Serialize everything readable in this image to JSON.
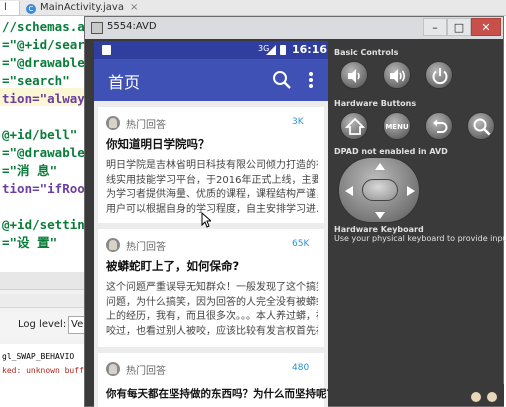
{
  "ide": {
    "tabs": [
      {
        "label": "l"
      },
      {
        "label": "MainActivity.java",
        "icon": "c-class-icon",
        "close": "×"
      }
    ],
    "code_lines": [
      [
        {
          "t": "//schemas.an",
          "c": "str"
        }
      ],
      [
        {
          "t": "=\"@+id/sear",
          "c": "str"
        }
      ],
      [
        {
          "t": "=\"@drawable",
          "c": "str"
        }
      ],
      [
        {
          "t": "=\"search\"",
          "c": "str"
        }
      ],
      [
        {
          "t": "tion=\"alway",
          "c": "attr"
        }
      ],
      [
        {
          "t": "",
          "c": "plain"
        }
      ],
      [
        {
          "t": "@+id/bell\"",
          "c": "str"
        }
      ],
      [
        {
          "t": "=\"@drawable",
          "c": "str"
        }
      ],
      [
        {
          "t": "=\"消 息\"",
          "c": "str"
        }
      ],
      [
        {
          "t": "tion=\"ifRoom",
          "c": "attr"
        }
      ],
      [
        {
          "t": "",
          "c": "plain"
        }
      ],
      [
        {
          "t": "@+id/settin",
          "c": "str"
        }
      ],
      [
        {
          "t": "=\"设 置\"",
          "c": "str"
        }
      ]
    ],
    "log_level_label": "Log level:",
    "log_level_value": "Ve",
    "log_lines": [
      {
        "text": "gl_SWAP_BEHAVIO",
        "color": "black"
      },
      {
        "text": "ked: unknown buff",
        "color": "red"
      }
    ]
  },
  "emulator": {
    "title": "5554:AVD",
    "window_buttons": {
      "min": "–",
      "max": "□",
      "close": "✕"
    },
    "phone": {
      "status_time": "16:16",
      "status_signal": "3G",
      "toolbar_title": "首页",
      "cards": [
        {
          "category": "热门回答",
          "badge": "3K",
          "title": "你知道明日学院吗？",
          "body": [
            "明日学院是吉林省明日科技有限公司倾力打造的在",
            "线实用技能学习平台，于2016年正式上线，主要",
            "为学习者提供海量、优质的课程，课程结构严谨，",
            "用户可以根据自身的学习程度，自主安排学习进..."
          ]
        },
        {
          "category": "热门回答",
          "badge": "65K",
          "title": "被蟒蛇盯上了，如何保命?",
          "body": [
            "这个问题严重误导无知群众！一般发现了这个搞笑的",
            "问题，为什么搞笑，因为回答的人完全没有被蟒蛇盯",
            "上的经历，我有，而且很多次。。。本人养过蟒，被",
            "咬过，也看过别人被咬，应该比较有发言权首先被..."
          ]
        },
        {
          "category": "热门回答",
          "badge": "480",
          "title": "你有每天都在坚持做的东西吗？为什么而坚持呢？",
          "body": []
        }
      ]
    },
    "panel": {
      "basic_controls_label": "Basic Controls",
      "hardware_buttons_label": "Hardware Buttons",
      "menu_label": "MENU",
      "dpad_label": "DPAD not enabled in AVD",
      "keyboard_label": "Hardware Keyboard",
      "keyboard_hint": "Use your physical keyboard to provide input"
    }
  }
}
